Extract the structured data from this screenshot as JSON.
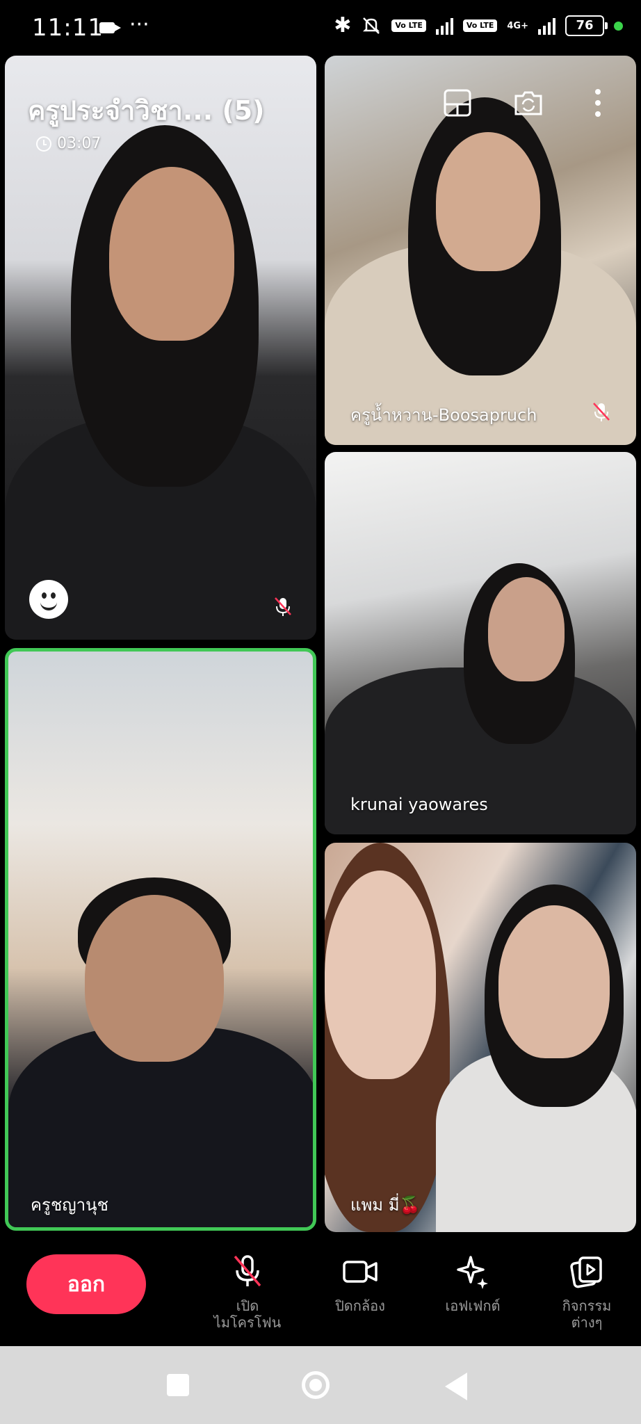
{
  "status_bar": {
    "time": "11:11",
    "dots": "···",
    "volte1": "Vo LTE",
    "volte2": "Vo LTE",
    "network": "4G+",
    "battery": "76"
  },
  "meeting": {
    "title": "ครูประจำวิชา... (5)",
    "elapsed": "03:07"
  },
  "participants": [
    {
      "name": "",
      "muted": true
    },
    {
      "name": "ครูน้ำหวาน-Boosapruch",
      "muted": true
    },
    {
      "name": "krunai yaowares",
      "muted": false
    },
    {
      "name": "ครูชญานุช",
      "muted": false,
      "speaking": true
    },
    {
      "name": "แพม มี่🍒",
      "muted": false
    }
  ],
  "controls": {
    "leave_label": "ออก",
    "mic_label_line1": "เปิด",
    "mic_label_line2": "ไมโครโฟน",
    "camera_label": "ปิดกล้อง",
    "effects_label": "เอฟเฟกต์",
    "activities_line1": "กิจกรรม",
    "activities_line2": "ต่างๆ"
  },
  "colors": {
    "leave": "#ff3458",
    "active_speaker": "#41c856",
    "status_dot": "#3bd44b"
  }
}
